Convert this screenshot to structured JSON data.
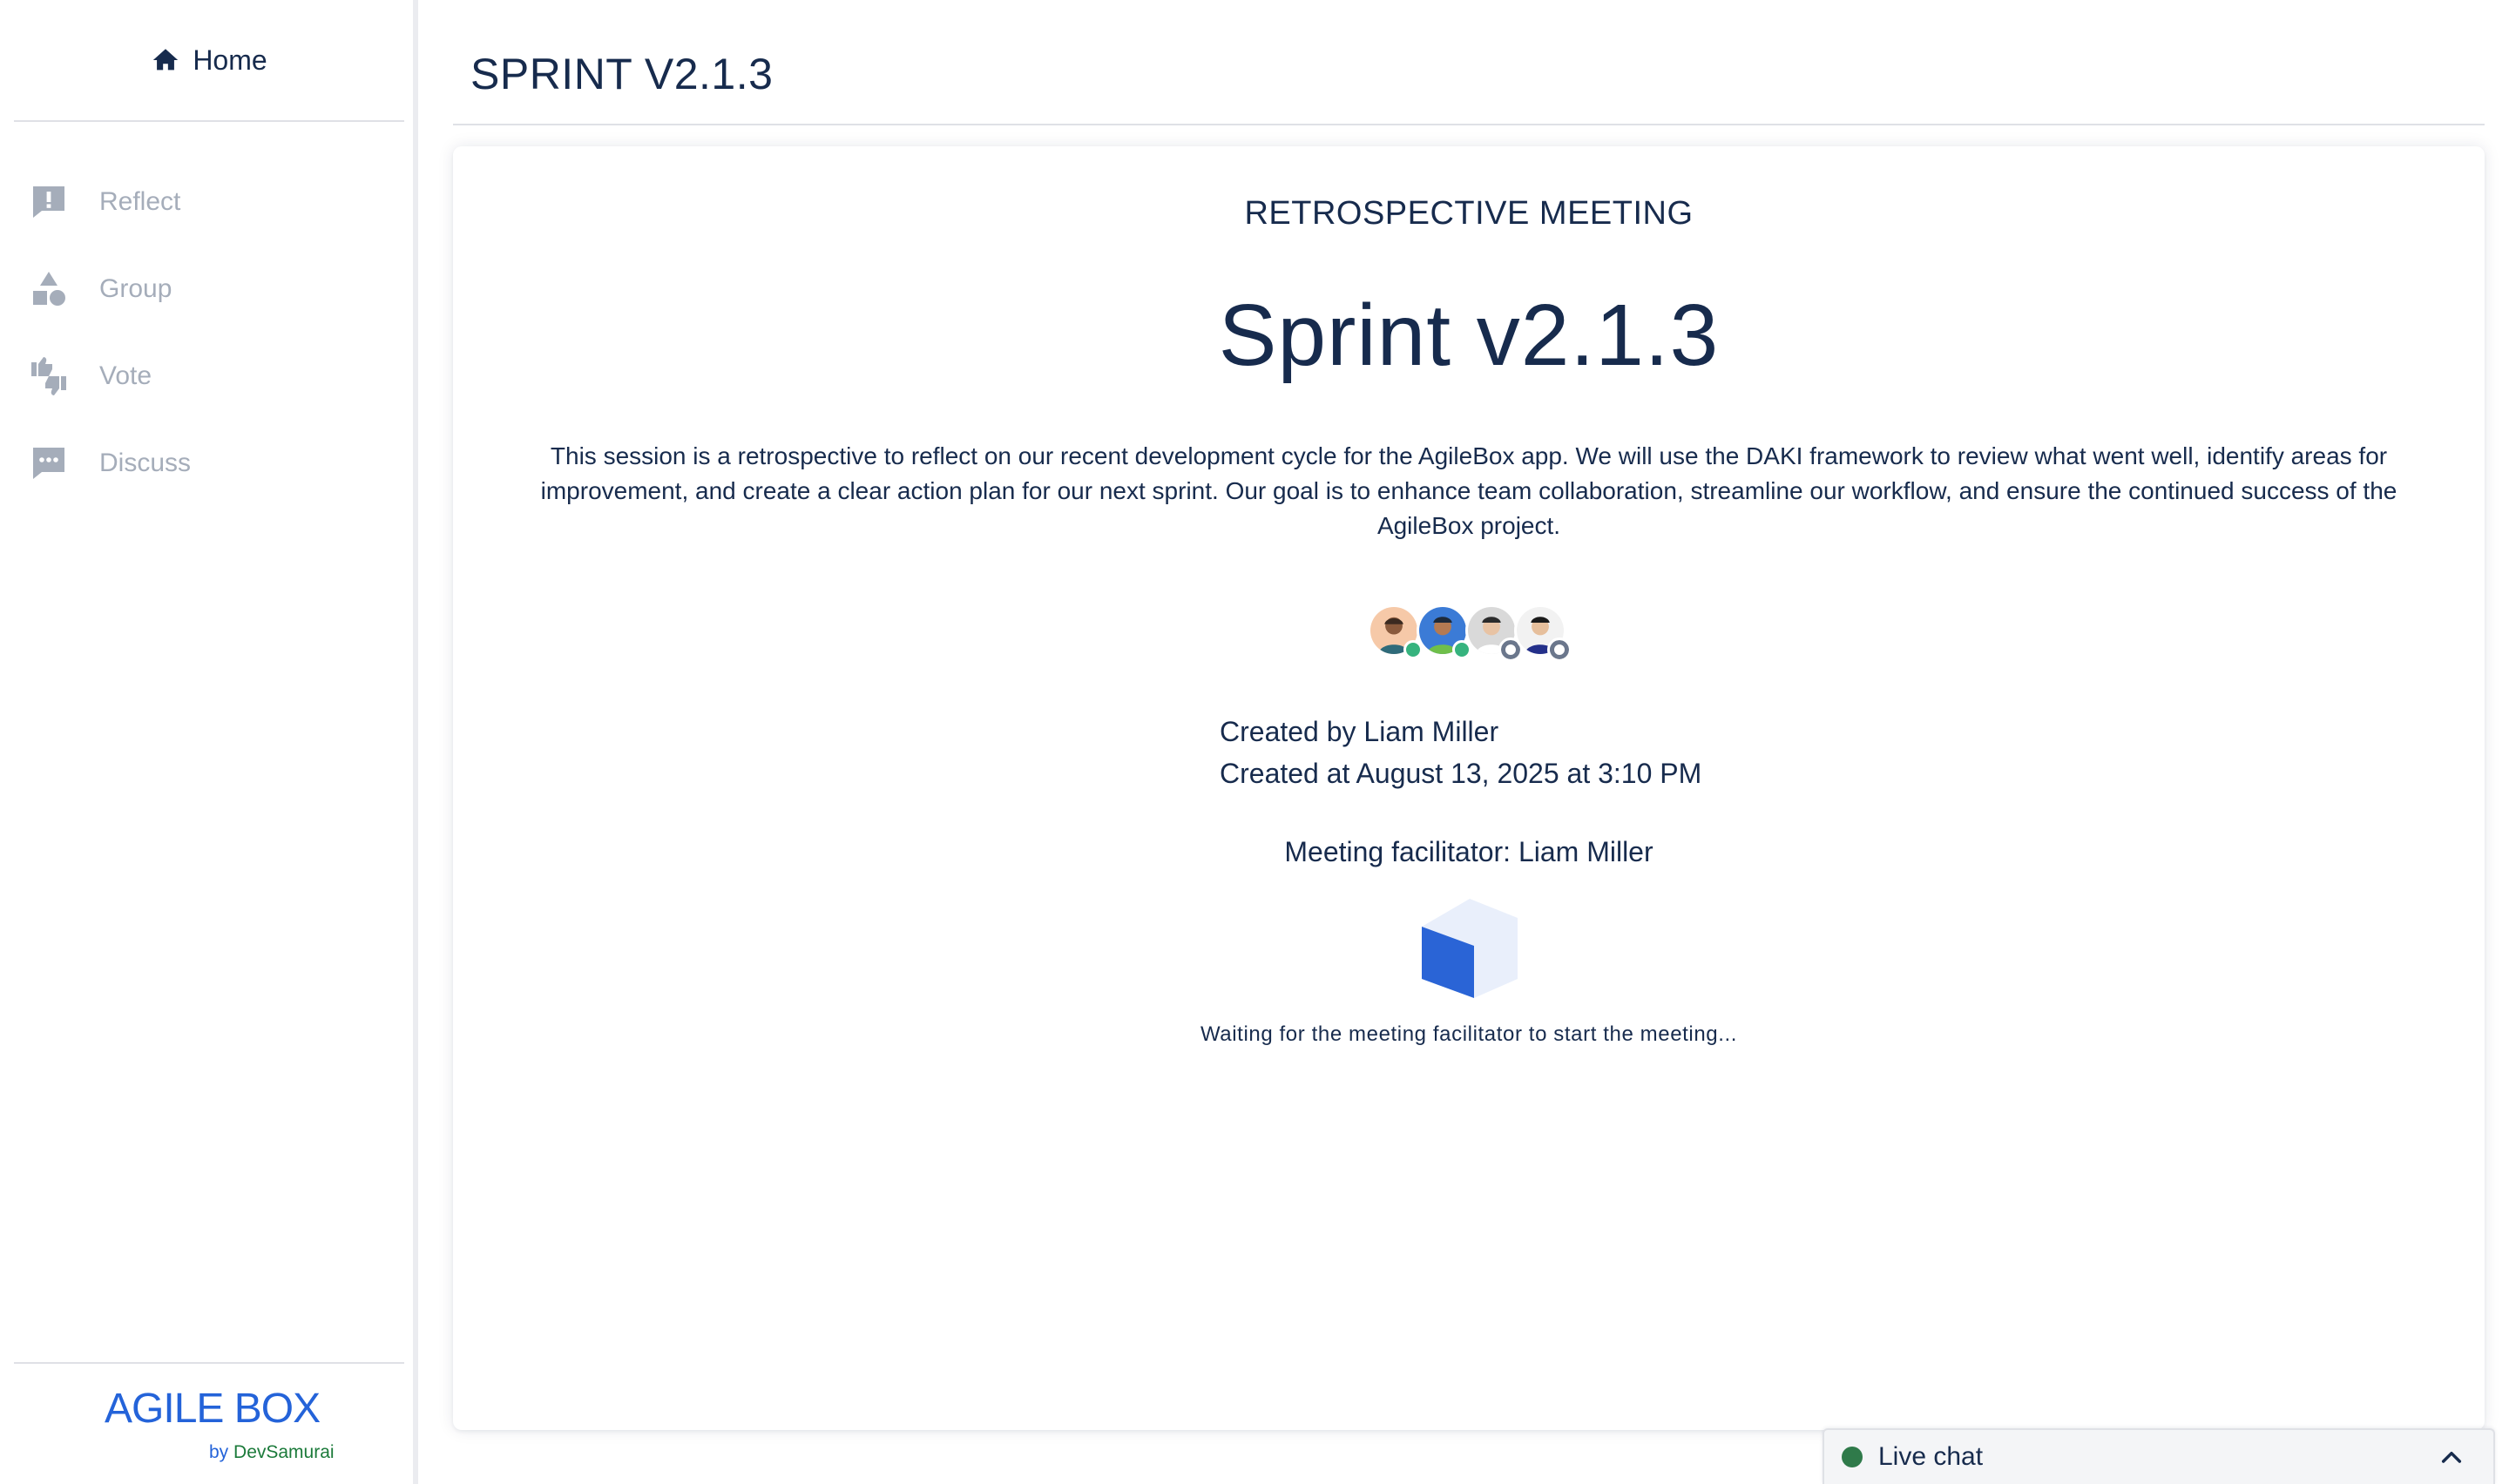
{
  "sidebar": {
    "home_label": "Home",
    "items": [
      {
        "label": "Reflect",
        "icon": "exclamation-comment-icon"
      },
      {
        "label": "Group",
        "icon": "shapes-icon"
      },
      {
        "label": "Vote",
        "icon": "thumbs-icon"
      },
      {
        "label": "Discuss",
        "icon": "chat-dots-icon"
      }
    ],
    "logo": "AGILE BOX",
    "logo_by": "by",
    "logo_company": "DevSamurai"
  },
  "header": {
    "title": "SPRINT V2.1.3"
  },
  "meeting": {
    "subtitle": "RETROSPECTIVE MEETING",
    "title": "Sprint v2.1.3",
    "description": "This session is a retrospective to reflect on our recent development cycle for the AgileBox app. We will use the DAKI framework to review what went well, identify areas for improvement, and create a clear action plan for our next sprint. Our goal is to enhance team collaboration, streamline our workflow, and ensure the continued success of the AgileBox project.",
    "participants": [
      {
        "status": "online"
      },
      {
        "status": "online"
      },
      {
        "status": "offline"
      },
      {
        "status": "offline"
      }
    ],
    "created_by": "Created by Liam Miller",
    "created_at": "Created at August 13, 2025 at 3:10 PM",
    "facilitator": "Meeting facilitator: Liam Miller",
    "waiting_text": "Waiting for the meeting facilitator to start the meeting..."
  },
  "livechat": {
    "label": "Live chat",
    "status_color": "#2f7a4a"
  },
  "colors": {
    "accent": "#2463d9",
    "text": "#172b4d",
    "muted": "#a5adba"
  }
}
